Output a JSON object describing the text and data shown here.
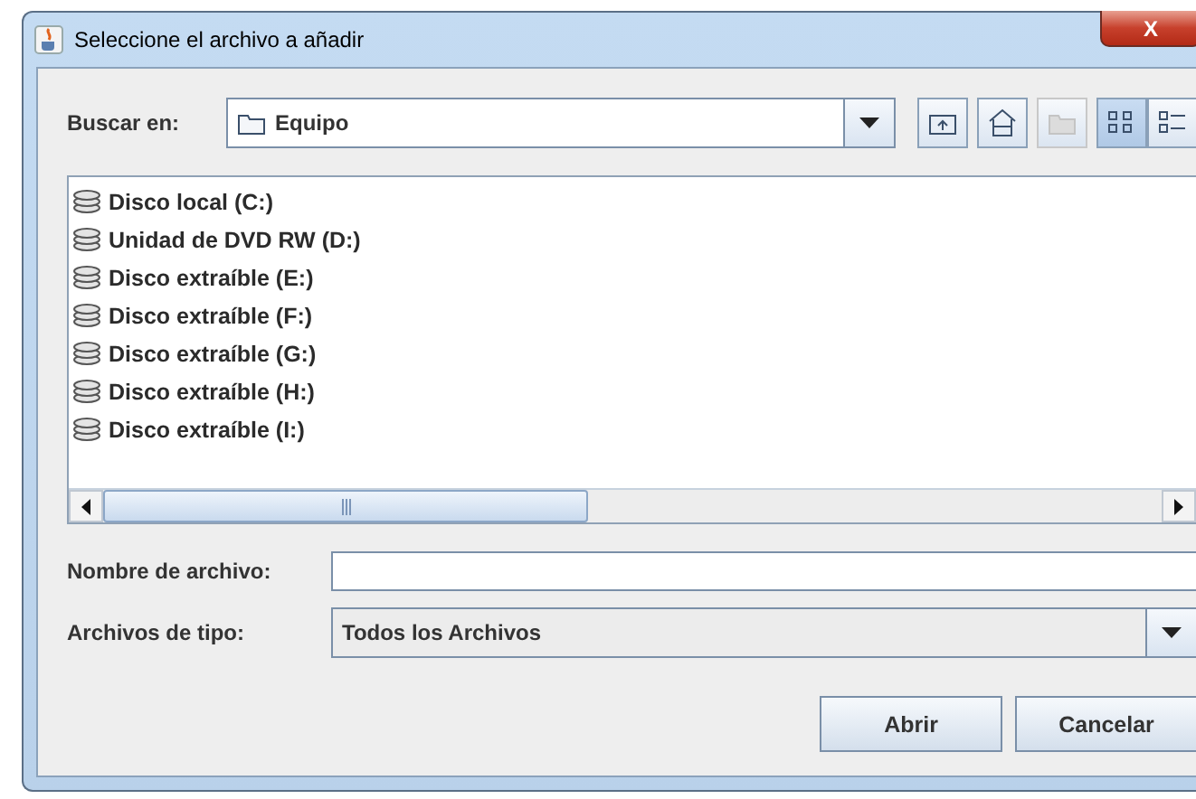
{
  "window": {
    "title": "Seleccione el archivo a añadir",
    "close_label": "X"
  },
  "look_in": {
    "label": "Buscar en:",
    "value": "Equipo"
  },
  "toolbar": [
    {
      "kind": "up",
      "disabled": false,
      "selected": false
    },
    {
      "kind": "home",
      "disabled": false,
      "selected": false
    },
    {
      "kind": "newfolder",
      "disabled": true,
      "selected": false
    },
    {
      "kind": "list",
      "disabled": false,
      "selected": true
    },
    {
      "kind": "details",
      "disabled": false,
      "selected": false
    }
  ],
  "files": [
    {
      "name": "Disco local (C:)"
    },
    {
      "name": "Unidad de DVD RW (D:)"
    },
    {
      "name": "Disco extraíble (E:)"
    },
    {
      "name": "Disco extraíble (F:)"
    },
    {
      "name": "Disco extraíble (G:)"
    },
    {
      "name": "Disco extraíble (H:)"
    },
    {
      "name": "Disco extraíble (I:)"
    }
  ],
  "file_name": {
    "label": "Nombre de archivo:"
  },
  "file_type": {
    "label": "Archivos de tipo:",
    "value": "Todos los Archivos"
  },
  "buttons": [
    {
      "label": "Abrir"
    },
    {
      "label": "Cancelar"
    }
  ]
}
